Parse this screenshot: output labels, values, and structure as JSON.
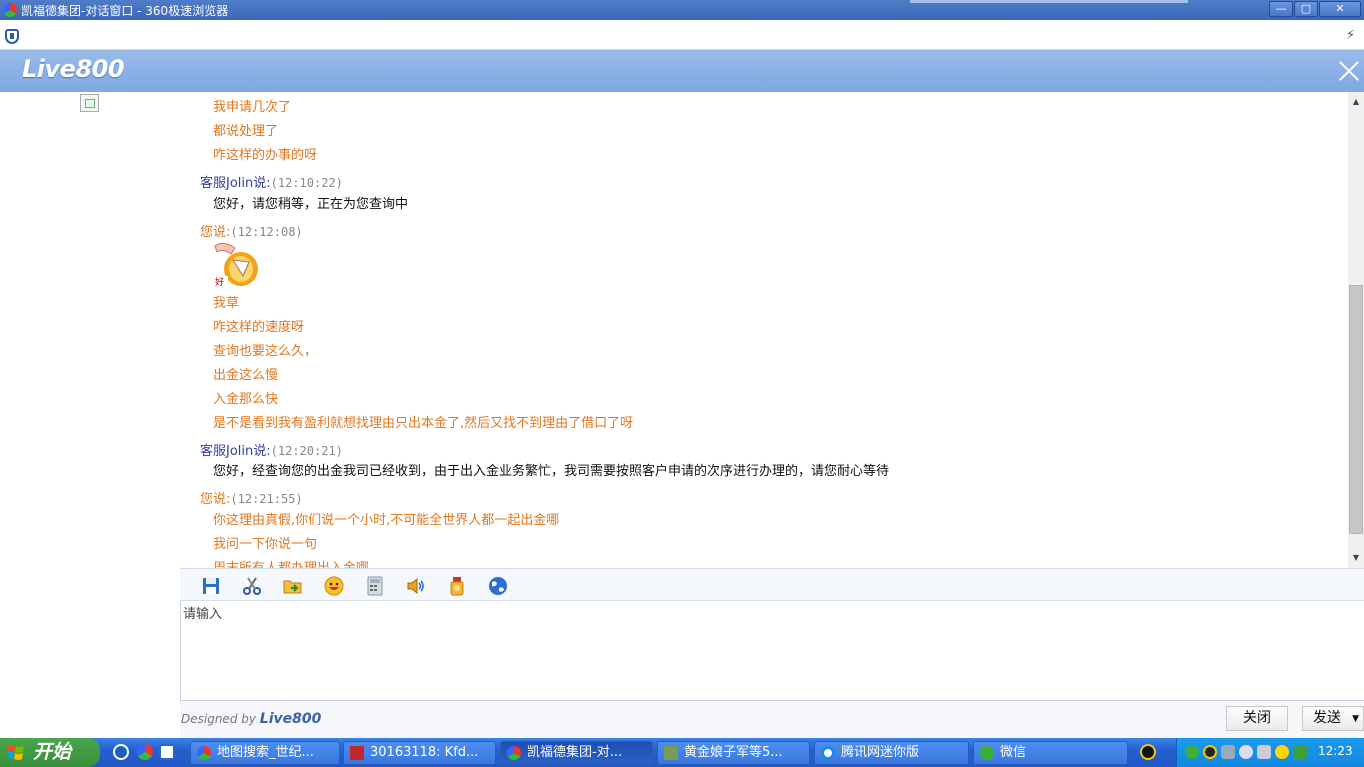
{
  "browser": {
    "title": "凯福德集团-对话窗口 - 360极速浏览器",
    "min_label": "—",
    "max_label": "▢",
    "close_label": "✕",
    "bolt": "⚡"
  },
  "brand": {
    "logo": "Live800"
  },
  "chat": {
    "messages": [
      {
        "line": "我申请几次了"
      },
      {
        "line": "都说处理了"
      },
      {
        "line": "咋这样的办事的呀"
      },
      {
        "who": "客服Jolin说:",
        "time": "(12:10:22)"
      },
      {
        "line": "您好，请您稍等，正在为您查询中"
      },
      {
        "who": "您说:",
        "time": "(12:12:08)"
      },
      {
        "line": "我草"
      },
      {
        "line": "咋这样的速度呀"
      },
      {
        "line": "查询也要这么久，"
      },
      {
        "line": "出金这么慢"
      },
      {
        "line": "入金那么快"
      },
      {
        "line": "是不是看到我有盈利就想找理由只出本金了,然后又找不到理由了借口了呀"
      },
      {
        "who": "客服Jolin说:",
        "time": "(12:20:21)"
      },
      {
        "line": "您好，经查询您的出金我司已经收到，由于出入金业务繁忙，我司需要按照客户申请的次序进行办理的，请您耐心等待"
      },
      {
        "who": "您说:",
        "time": "(12:21:55)"
      },
      {
        "line": "你这理由真假,你们说一个小时,不可能全世界人都一起出金哪"
      },
      {
        "line": "我问一下你说一句"
      },
      {
        "line": "周末所有人都办理出入金哪"
      }
    ]
  },
  "toolbar": {
    "icons": [
      "save-icon",
      "scissors-icon",
      "open-folder-icon",
      "emoticon-icon",
      "calculator-icon",
      "sound-icon",
      "medal-icon",
      "globe-icon"
    ]
  },
  "input": {
    "placeholder": "请输入"
  },
  "footer": {
    "designed_by": "Designed by",
    "brand": "Live800",
    "close_label": "关闭",
    "send_label": "发送",
    "send_caret": "▼"
  },
  "taskbar": {
    "start_label": "开始",
    "tasks": [
      "地图搜索_世纪...",
      "30163118: Kfd...",
      "凯福德集团-对...",
      "黄金娘子军等5...",
      "腾讯网迷你版",
      "微信"
    ],
    "clock": "12:23"
  },
  "colors": {
    "user_text": "#e07820",
    "agent_name": "#3340a0",
    "header_bg": "#8db1e6",
    "taskbar": "#2560d0"
  }
}
